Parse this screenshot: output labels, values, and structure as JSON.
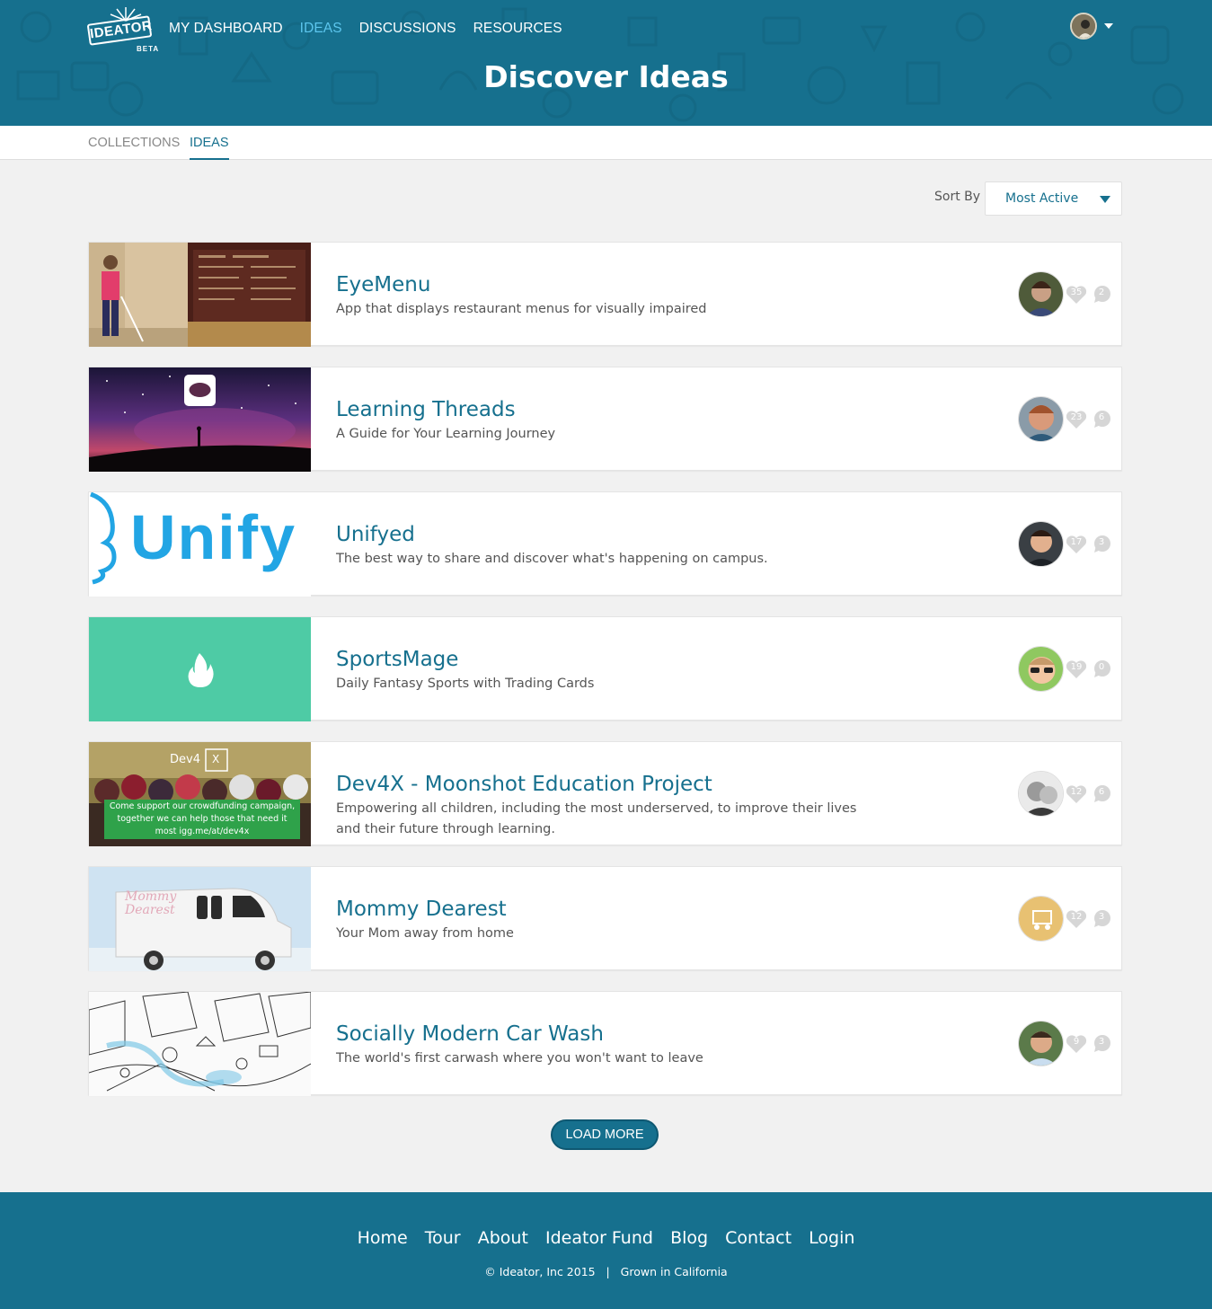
{
  "header": {
    "logo_text": "IDEATOR",
    "logo_badge": "BETA",
    "nav": [
      {
        "label": "MY DASHBOARD"
      },
      {
        "label": "IDEAS"
      },
      {
        "label": "DISCUSSIONS"
      },
      {
        "label": "RESOURCES"
      }
    ],
    "active_nav": "IDEAS",
    "title": "Discover Ideas"
  },
  "subtabs": {
    "items": [
      {
        "label": "COLLECTIONS"
      },
      {
        "label": "IDEAS"
      }
    ],
    "active": "IDEAS"
  },
  "sort": {
    "label": "Sort By",
    "value": "Most Active"
  },
  "ideas": [
    {
      "title": "EyeMenu",
      "description": "App that displays restaurant menus for visually impaired",
      "likes": "35",
      "comments": "2"
    },
    {
      "title": "Learning Threads",
      "description": "A Guide for Your Learning Journey",
      "likes": "23",
      "comments": "6"
    },
    {
      "title": "Unifyed",
      "description": "The best way to share and discover what's happening on campus.",
      "likes": "17",
      "comments": "3",
      "thumb_text": "Unify"
    },
    {
      "title": "SportsMage",
      "description": "Daily Fantasy Sports with Trading Cards",
      "likes": "19",
      "comments": "0"
    },
    {
      "title": "Dev4X - Moonshot Education Project",
      "description": "Empowering all children, including the most underserved, to improve their lives and their future through learning.",
      "likes": "12",
      "comments": "6",
      "thumb_text": "Dev4",
      "thumb_text_2": "X",
      "thumb_banner": "Come support our crowdfunding campaign, together we can help those that need it most igg.me/at/dev4x"
    },
    {
      "title": "Mommy Dearest",
      "description": "Your Mom away from home",
      "likes": "12",
      "comments": "3",
      "thumb_text": "Mommy Dearest"
    },
    {
      "title": "Socially Modern Car Wash",
      "description": "The world's first carwash where you won't want to leave",
      "likes": "9",
      "comments": "3"
    }
  ],
  "load_more": "LOAD MORE",
  "footer": {
    "links": [
      {
        "label": "Home"
      },
      {
        "label": "Tour"
      },
      {
        "label": "About"
      },
      {
        "label": "Ideator Fund"
      },
      {
        "label": "Blog"
      },
      {
        "label": "Contact"
      },
      {
        "label": "Login"
      }
    ],
    "copyright": "© Ideator, Inc 2015   |   Grown in California"
  },
  "colors": {
    "brand": "#16708e",
    "accent": "#5cc6ee",
    "background": "#f1f1f1"
  }
}
